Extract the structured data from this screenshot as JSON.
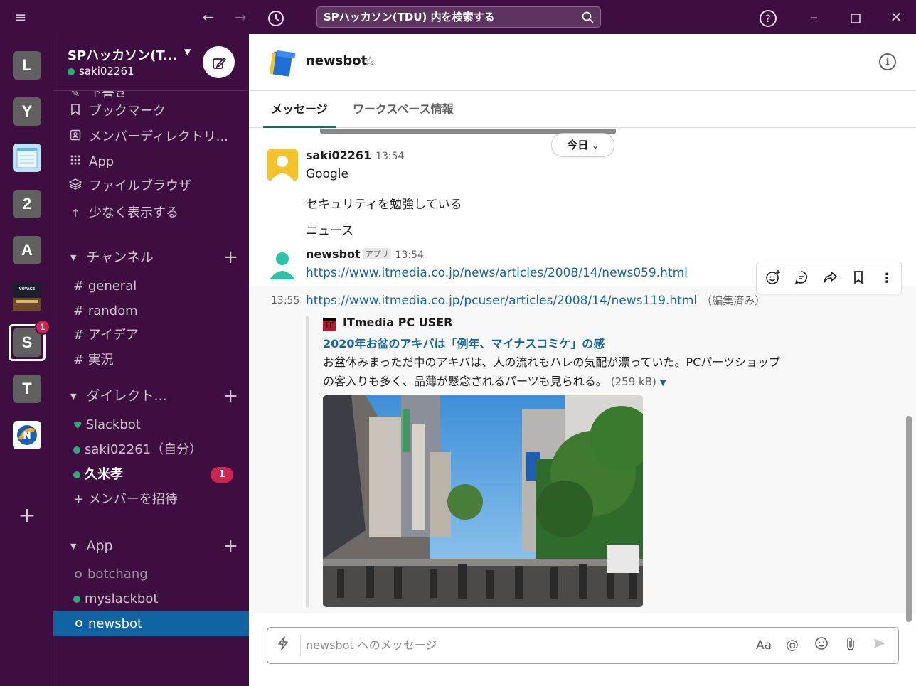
{
  "titlebar": {
    "search_text": "SPハッカソン(TDU) 内を検索する"
  },
  "rail": {
    "workspaces": [
      {
        "label": "L"
      },
      {
        "label": "Y"
      },
      {
        "label": ""
      },
      {
        "label": "2"
      },
      {
        "label": "A"
      },
      {
        "label": ""
      },
      {
        "label": "S",
        "badge": "1"
      },
      {
        "label": "T"
      },
      {
        "label": ""
      }
    ]
  },
  "sidebar": {
    "workspace_name": "SPハッカソン(T...",
    "user": "saki02261",
    "nav_items": [
      "下書き",
      "ブックマーク",
      "メンバーディレクトリ...",
      "App",
      "ファイルブラウザ",
      "少なく表示する"
    ],
    "channels_title": "チャンネル",
    "channels": [
      "general",
      "random",
      "アイデア",
      "実況"
    ],
    "dm_title": "ダイレクト...",
    "dms": [
      {
        "name": "Slackbot"
      },
      {
        "name": "saki02261（自分）"
      },
      {
        "name": "久米孝",
        "badge": "1"
      }
    ],
    "invite": "メンバーを招待",
    "app_title": "App",
    "apps": [
      "botchang",
      "myslackbot",
      "newsbot"
    ]
  },
  "channel": {
    "name": "newsbot",
    "tabs": [
      "メッセージ",
      "ワークスペース情報"
    ]
  },
  "messages": {
    "today": "今日",
    "m1": {
      "user": "saki02261",
      "time": "13:54",
      "lines": [
        "Google",
        "セキュリティを勉強している",
        "ニュース"
      ]
    },
    "m2": {
      "user": "newsbot",
      "app_tag": "アプリ",
      "time": "13:54",
      "link": "https://www.itmedia.co.jp/news/articles/2008/14/news059.html"
    },
    "m3": {
      "time": "13:55",
      "link": "https://www.itmedia.co.jp/pcuser/articles/2008/14/news119.html",
      "edited": "（編集済み）",
      "unfurl": {
        "source": "ITmedia PC USER",
        "logo_text": "IT",
        "title": "2020年お盆のアキバは「例年、マイナスコミケ」の感",
        "desc_line1": "お盆休みまっただ中のアキバは、人の流れもハレの気配が漂っていた。PCパーツショップ",
        "desc_line2": "の客入りも多く、品薄が懸念されるパーツも見られる。",
        "size": "(259 kB)"
      }
    }
  },
  "composer": {
    "placeholder": "newsbot へのメッセージ",
    "format_label": "Aa"
  },
  "colors": {
    "aubergine": "#3f0e40",
    "selected": "#1164a3",
    "link": "#1264a3",
    "badge": "#cd2553",
    "online": "#2bac76"
  }
}
